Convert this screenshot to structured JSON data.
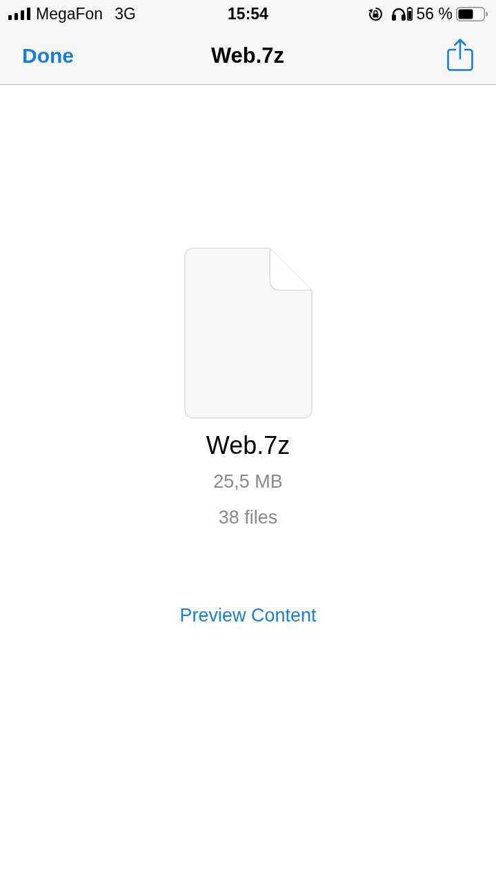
{
  "status_bar": {
    "carrier": "MegaFon",
    "network": "3G",
    "time": "15:54",
    "battery_percent": "56 %"
  },
  "nav_bar": {
    "done_button": "Done",
    "title": "Web.7z"
  },
  "file": {
    "name": "Web.7z",
    "size": "25,5 MB",
    "count": "38 files"
  },
  "preview_link": "Preview Content"
}
